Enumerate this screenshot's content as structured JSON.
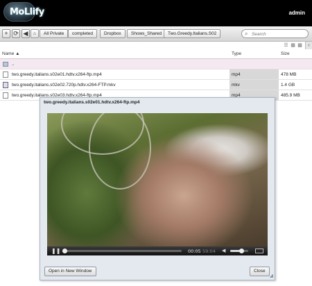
{
  "app": {
    "logo_text": "MoLlify",
    "username": "admin"
  },
  "toolbar": {
    "add_label": "+",
    "refresh_label": "⟳",
    "back_label": "◀",
    "home_label": "⌂",
    "breadcrumbs": [
      "All Private",
      "completed",
      "Dropbox",
      "Shows_Shared",
      "Two.Greedy.Italians.S02"
    ],
    "search_placeholder": "Search"
  },
  "list": {
    "columns": {
      "name": "Name ▲",
      "type": "Type",
      "size": "Size"
    },
    "parent_label": "..",
    "rows": [
      {
        "name": "two.greedy.italians.s02e01.hdtv.x264-ftp.mp4",
        "type": "mp4",
        "size": "478 MB"
      },
      {
        "name": "two.greedy.italians.s02e02.720p.hdtv.x264-FTP.mkv",
        "type": "mkv",
        "size": "1.4 GB"
      },
      {
        "name": "two.greedy.italians.s02e03.hdtv.x264-ftp.mp4",
        "type": "mp4",
        "size": "485.9 MB"
      }
    ]
  },
  "dialog": {
    "title": "two.greedy.italians.s02e01.hdtv.x264-ftp.mp4",
    "current_time": "00:05",
    "duration": "59:04",
    "progress": 0.02,
    "volume": 0.6,
    "open_new_window_label": "Open in New Window",
    "close_label": "Close"
  }
}
